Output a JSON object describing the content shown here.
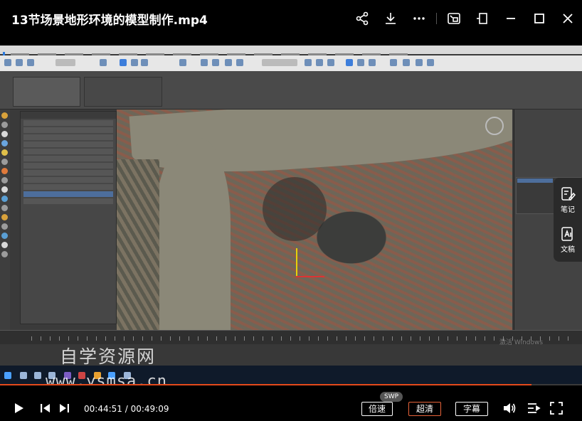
{
  "player": {
    "title": "13节场景地形环境的模型制作.mp4",
    "current_time": "00:44:51",
    "duration": "00:49:09",
    "time_separator": " / ",
    "progress_fraction": 0.913,
    "speed_label": "倍速",
    "speed_badge": "SWP",
    "quality_label": "超清",
    "subtitle_label": "字幕",
    "accent_color": "#e34a1b"
  },
  "top_icons": [
    "share-icon",
    "download-icon",
    "more-icon",
    "picture-in-picture-icon",
    "pin-icon",
    "minimize-icon",
    "maximize-icon",
    "close-icon"
  ],
  "side_panel": {
    "items": [
      {
        "label": "笔记",
        "icon": "note-edit-icon"
      },
      {
        "label": "文稿",
        "icon": "transcript-ai-icon"
      }
    ]
  },
  "overlay": {
    "watermark_cn": "自学资源网",
    "watermark_url": "www.ysmsa.cn",
    "windows_activate": "激活 Windows"
  }
}
